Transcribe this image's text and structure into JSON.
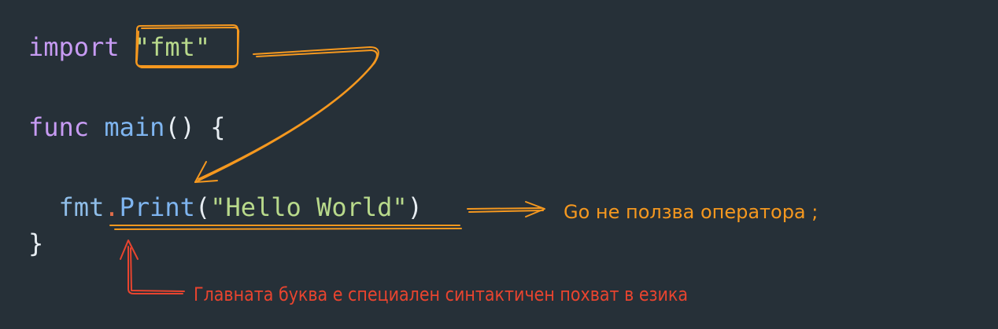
{
  "code": {
    "line1": {
      "keyword": "import",
      "package_string": "\"fmt\""
    },
    "line2": {
      "keyword": "func",
      "function_name": "main",
      "parens": "()",
      "open_brace": "{"
    },
    "line3": {
      "indent": "  ",
      "package": "fmt",
      "dot": ".",
      "method": "Print",
      "open_paren": "(",
      "string": "\"Hello World\"",
      "close_paren": ")"
    },
    "line4": {
      "close_brace": "}"
    }
  },
  "annotations": {
    "semicolon_note": "Go не ползва оператора ;",
    "capital_letter_note": "Главната буква е специален синтактичен похват в езика"
  },
  "colors": {
    "background": "#263038",
    "keyword": "#c79bf3",
    "string": "#b8d98b",
    "function": "#7fb5f0",
    "annotation_orange": "#f5981f",
    "annotation_red": "#e8442f"
  }
}
